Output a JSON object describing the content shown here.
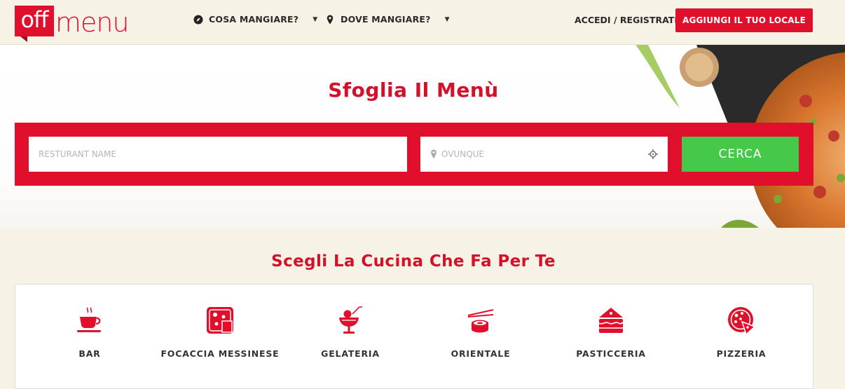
{
  "brand": {
    "box_text": "off",
    "text": "menu",
    "color": "#e0102d"
  },
  "nav": {
    "what_to_eat": {
      "label": "COSA MANGIARE?",
      "icon": "compass-icon"
    },
    "where_to_eat": {
      "label": "DOVE MANGIARE?",
      "icon": "location-pin-icon"
    },
    "login": "ACCEDI / REGISTRATI",
    "add_venue": "AGGIUNGI IL TUO LOCALE"
  },
  "hero": {
    "title": "Sfoglia Il Menù",
    "search": {
      "name_placeholder": "RESTURANT NAME",
      "location_placeholder": "OVUNQUE",
      "button": "CERCA"
    }
  },
  "cuisines": {
    "title": "Scegli La Cucina Che Fa Per Te",
    "items": [
      {
        "label": "BAR",
        "icon": "coffee-cup-icon"
      },
      {
        "label": "FOCACCIA MESSINESE",
        "icon": "focaccia-icon"
      },
      {
        "label": "GELATERIA",
        "icon": "gelato-cup-icon"
      },
      {
        "label": "ORIENTALE",
        "icon": "sushi-icon"
      },
      {
        "label": "PASTICCERIA",
        "icon": "cake-slice-icon"
      },
      {
        "label": "PIZZERIA",
        "icon": "pizza-icon"
      }
    ]
  },
  "colors": {
    "accent": "#e0102d",
    "search_button": "#46c94a",
    "background": "#f6f2e6"
  }
}
